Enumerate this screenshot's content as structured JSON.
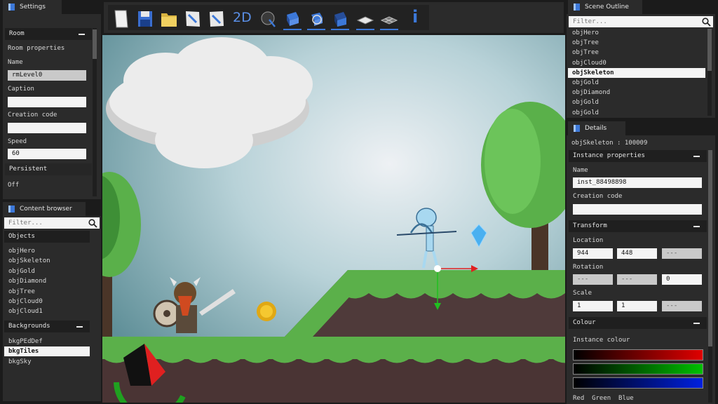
{
  "settings": {
    "tab": "Settings",
    "room_header": "Room",
    "room_properties": "Room properties",
    "name_label": "Name",
    "name_value": "rmLevel0",
    "caption_label": "Caption",
    "caption_value": "",
    "creation_code_label": "Creation code",
    "creation_code_value": "",
    "speed_label": "Speed",
    "speed_value": "60",
    "persistent_label": "Persistent",
    "persistent_value": "Off"
  },
  "content_browser": {
    "tab": "Content browser",
    "filter_placeholder": "Filter...",
    "objects_header": "Objects",
    "objects": [
      "objHero",
      "objSkeleton",
      "objGold",
      "objDiamond",
      "objTree",
      "objCloud0",
      "objCloud1"
    ],
    "backgrounds_header": "Backgrounds",
    "backgrounds": [
      "bkgPEdDef",
      "bkgTiles",
      "bkgSky"
    ],
    "selected_background": "bkgTiles"
  },
  "toolbar": {
    "mode_2d": "2D",
    "info_label": "i",
    "tools": [
      "new-page-icon",
      "save-disk-icon",
      "open-folder-icon",
      "shrink-arrow-icon",
      "expand-arrow-icon",
      "2d-mode",
      "globe-cursor-icon",
      "move-tool-icon",
      "rotate-tool-icon",
      "scale-tool-icon",
      "grid-plane-icon",
      "grid-wire-icon",
      "info-icon"
    ]
  },
  "scene_outline": {
    "tab": "Scene Outline",
    "filter_placeholder": "Filter...",
    "items": [
      "objHero",
      "objTree",
      "objTree",
      "objCloud0",
      "objSkeleton",
      "objGold",
      "objDiamond",
      "objGold",
      "objGold"
    ],
    "selected_index": 4
  },
  "details": {
    "tab": "Details",
    "instance_id": "objSkeleton : 100009",
    "instance_properties": "Instance properties",
    "name_label": "Name",
    "name_value": "inst_88498898",
    "creation_code_label": "Creation code",
    "creation_code_value": "",
    "transform_header": "Transform",
    "location_label": "Location",
    "location": [
      "944",
      "448",
      "---"
    ],
    "rotation_label": "Rotation",
    "rotation": [
      "---",
      "---",
      "0"
    ],
    "scale_label": "Scale",
    "scale": [
      "1",
      "1",
      "---"
    ],
    "colour_header": "Colour",
    "instance_colour_label": "Instance colour",
    "channel_labels": "Red  Green  Blue",
    "colors": {
      "red": "#e00000",
      "green": "#00c000",
      "blue": "#0020e0"
    }
  }
}
